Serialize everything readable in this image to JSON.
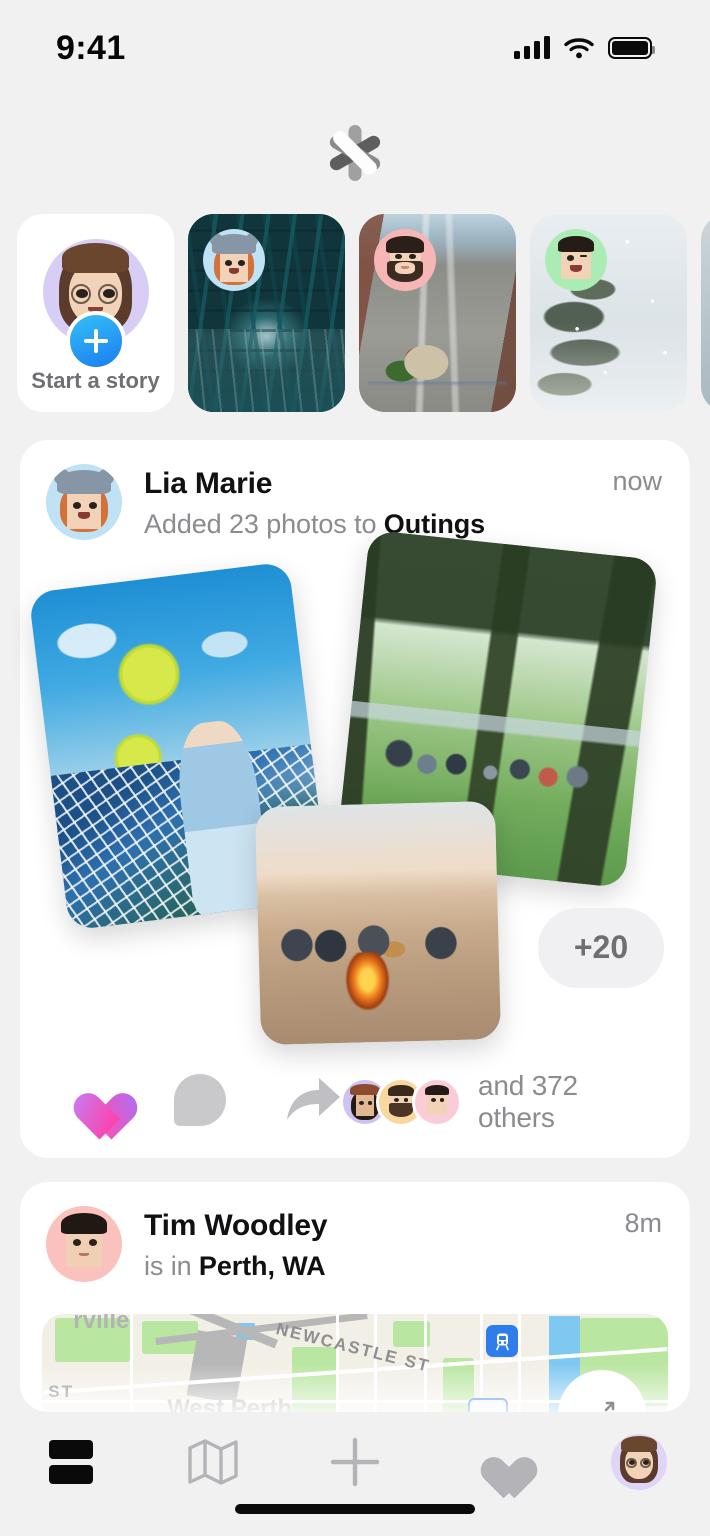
{
  "status_bar": {
    "time": "9:41",
    "signal_icon": "signal-bars-icon",
    "wifi_icon": "wifi-icon",
    "battery_icon": "battery-full-icon"
  },
  "app": {
    "logo_icon": "asterisk-logo-icon"
  },
  "stories": {
    "start_story": {
      "label": "Start a story",
      "avatar_icon": "memoji-avatar-self",
      "add_icon": "plus-icon"
    },
    "items": [
      {
        "avatar_icon": "memoji-avatar-lia",
        "photo": "bridge-tunnel-photo",
        "avatar_bg": "#bfe3f5"
      },
      {
        "avatar_icon": "memoji-avatar-beard",
        "photo": "bicycle-street-photo",
        "avatar_bg": "#f7b6b6"
      },
      {
        "avatar_icon": "memoji-avatar-green",
        "photo": "snowy-tree-photo",
        "avatar_bg": "#aaecb4"
      },
      {
        "avatar_icon": "memoji-avatar-peek",
        "photo": "partial-photo",
        "avatar_bg": "#d0d8dc"
      }
    ]
  },
  "posts": [
    {
      "author": "Lia Marie",
      "timestamp": "now",
      "action_prefix": "Added 23 photos to ",
      "action_target": "Outings",
      "avatar_icon": "memoji-avatar-lia",
      "photos": [
        {
          "name": "tennis-court-photo"
        },
        {
          "name": "park-picnic-photo"
        },
        {
          "name": "beach-bonfire-photo"
        }
      ],
      "more_count": "+20",
      "actions": {
        "like_icon": "heart-filled-icon",
        "comment_icon": "comment-bubble-icon",
        "share_icon": "share-arrow-icon"
      },
      "likes_text": "and 372 others",
      "liker_avatars": [
        {
          "name": "memoji-avatar-liker-1",
          "bg": "#cfc2f2"
        },
        {
          "name": "memoji-avatar-liker-2",
          "bg": "#f7d9a0"
        },
        {
          "name": "memoji-avatar-liker-3",
          "bg": "#f9ccd8"
        }
      ]
    },
    {
      "author": "Tim Woodley",
      "timestamp": "8m",
      "action_prefix": "is in ",
      "action_target": "Perth, WA",
      "avatar_icon": "memoji-avatar-tim",
      "map": {
        "labels": [
          "NEWCASTLE ST",
          "West Perth",
          "ST"
        ],
        "partial_label": "rville",
        "station_icon": "train-station-icon",
        "place_icon": "place-marker-icon",
        "expand_icon": "expand-arrows-icon"
      }
    }
  ],
  "tabbar": {
    "items": [
      {
        "name": "feed",
        "icon": "feed-icon",
        "active": true
      },
      {
        "name": "map",
        "icon": "map-icon",
        "active": false
      },
      {
        "name": "create",
        "icon": "plus-icon",
        "active": false
      },
      {
        "name": "activity",
        "icon": "heart-icon",
        "active": false
      },
      {
        "name": "profile",
        "icon": "profile-avatar-icon",
        "active": false
      }
    ],
    "home_indicator": "home-indicator"
  },
  "colors": {
    "background": "#f1f1f1",
    "card": "#ffffff",
    "text_primary": "#111114",
    "text_secondary": "#8b8b90",
    "accent_blue": "#1a7df0",
    "accent_pink": "#ff3fa8"
  }
}
